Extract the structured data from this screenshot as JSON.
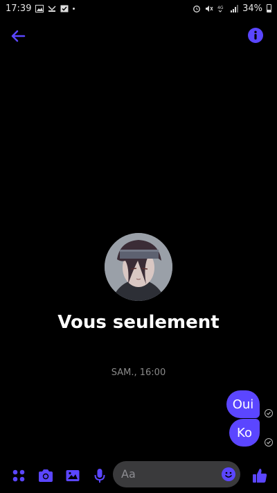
{
  "status": {
    "time": "17:39",
    "battery": "34%"
  },
  "header": {
    "back_icon": "arrow-left-icon",
    "info_icon": "info-icon"
  },
  "profile": {
    "title": "Vous seulement",
    "timestamp": "SAM., 16:00"
  },
  "messages": [
    {
      "text": "Oui",
      "status": "seen"
    },
    {
      "text": "Ko",
      "status": "seen"
    }
  ],
  "composer": {
    "placeholder": "Aa",
    "icons": [
      "menu-dots-icon",
      "camera-icon",
      "gallery-icon",
      "microphone-icon",
      "emoji-icon",
      "like-icon"
    ]
  },
  "colors": {
    "accent": "#5b46ff",
    "background": "#000000",
    "input_bg": "#3a3a3c"
  }
}
